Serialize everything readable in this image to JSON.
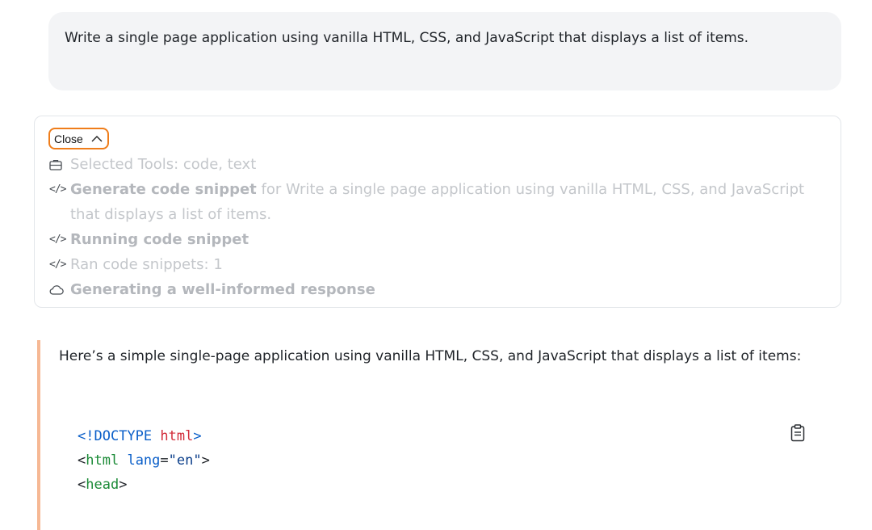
{
  "user_message": {
    "text": "Write a single page application using vanilla HTML, CSS, and JavaScript that displays a list of items."
  },
  "tools_panel": {
    "close_label": "Close",
    "close_icon": "chevron-up-icon",
    "steps": [
      {
        "icon": "briefcase-icon",
        "bold": "",
        "text": "Selected Tools: code, text"
      },
      {
        "icon": "code-icon",
        "bold": "Generate code snippet",
        "text": " for Write a single page application using vanilla HTML, CSS, and JavaScript that displays a list of items."
      },
      {
        "icon": "code-icon",
        "bold": "Running code snippet",
        "text": ""
      },
      {
        "icon": "code-icon",
        "bold": "",
        "text": "Ran code snippets: 1"
      },
      {
        "icon": "cloud-icon",
        "bold": "Generating a well-informed response",
        "text": ""
      }
    ]
  },
  "answer": {
    "intro": "Here’s a simple single-page application using vanilla HTML, CSS, and JavaScript that displays a list of items:",
    "code_lines": [
      {
        "parts": [
          {
            "t": "<!DOCTYPE ",
            "c": "kw"
          },
          {
            "t": "html",
            "c": "name"
          },
          {
            "t": ">",
            "c": "kw"
          }
        ]
      },
      {
        "parts": [
          {
            "t": "<",
            "c": "punct"
          },
          {
            "t": "html",
            "c": "tag"
          },
          {
            "t": " ",
            "c": "punct"
          },
          {
            "t": "lang",
            "c": "attr"
          },
          {
            "t": "=",
            "c": "punct"
          },
          {
            "t": "\"en\"",
            "c": "str"
          },
          {
            "t": ">",
            "c": "punct"
          }
        ]
      },
      {
        "parts": [
          {
            "t": "<",
            "c": "punct"
          },
          {
            "t": "head",
            "c": "tag"
          },
          {
            "t": ">",
            "c": "punct"
          }
        ]
      }
    ],
    "copy_icon": "clipboard-icon"
  },
  "colors": {
    "accent_orange": "#ef7d1a",
    "answer_border": "#f6b894",
    "user_bubble": "#f3f4f6"
  }
}
